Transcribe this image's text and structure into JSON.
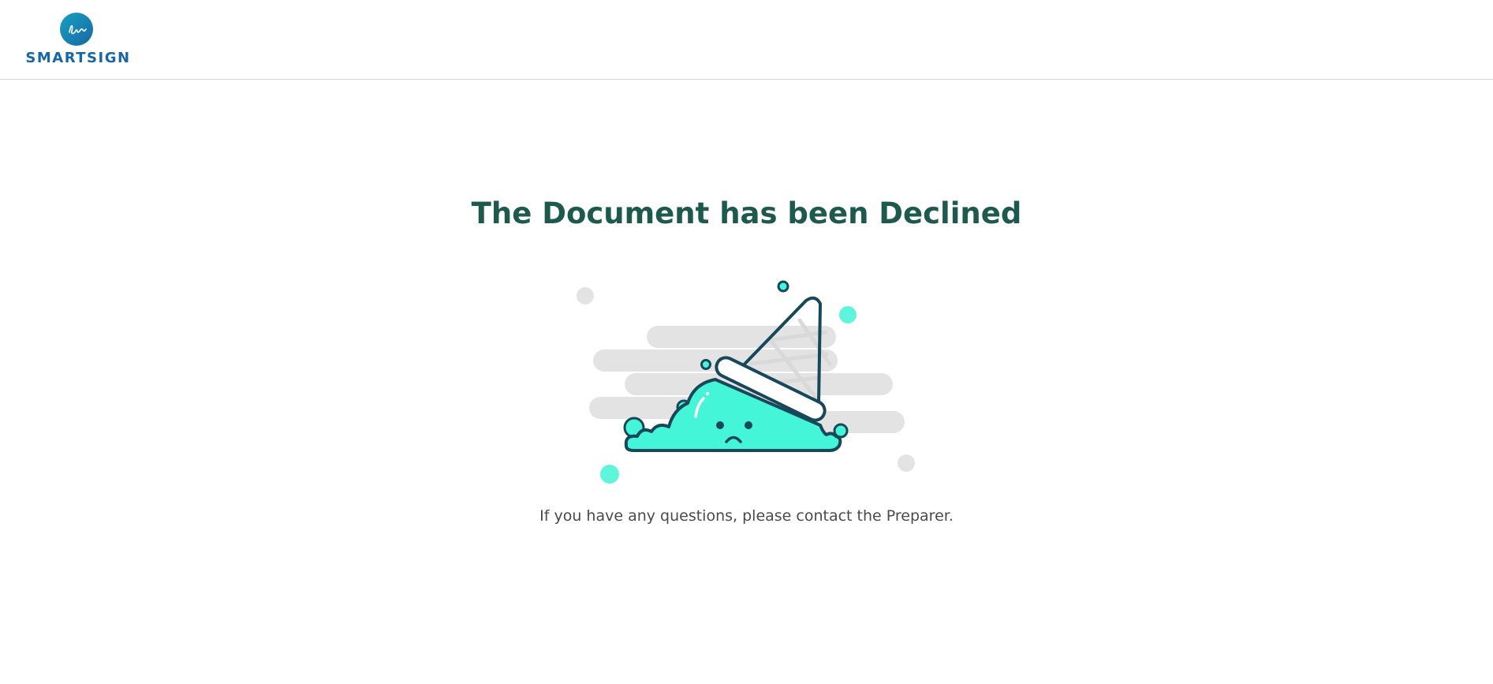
{
  "header": {
    "brand_name": "SMARTSIGN",
    "brand_color": "#1767a4"
  },
  "main": {
    "title": "The Document has been Declined",
    "message": "If you have any questions, please contact the Preparer.",
    "illustration": "dropped-ice-cream-icon",
    "title_color": "#1d5a4d",
    "accent_color": "#44f5d8",
    "outline_color": "#17475a"
  }
}
